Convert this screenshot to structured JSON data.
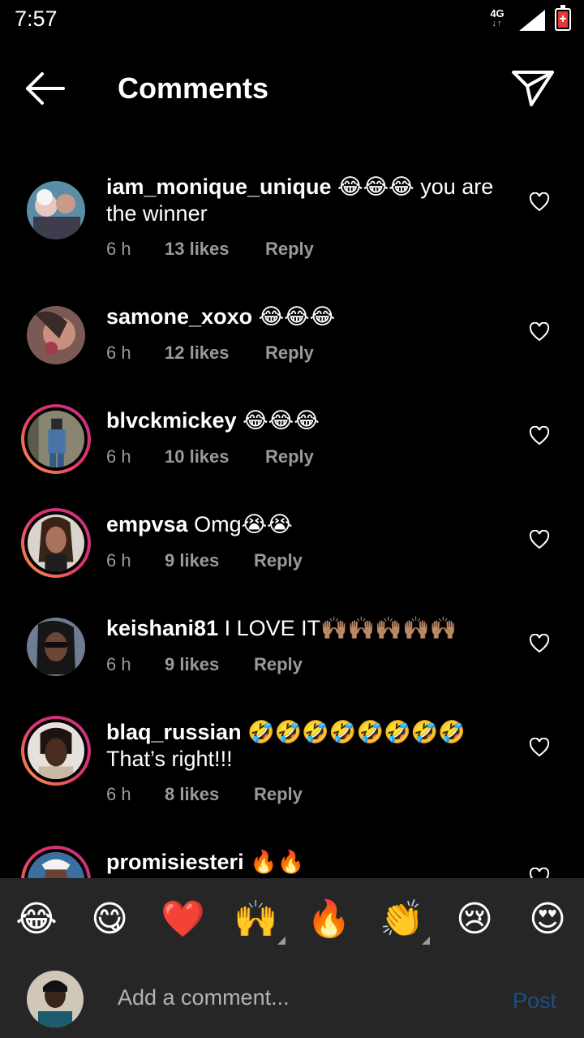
{
  "status_bar": {
    "time": "7:57",
    "network": "4G",
    "network_arrows": "↓↑"
  },
  "header": {
    "title": "Comments"
  },
  "comments": [
    {
      "username": "iam_monique_unique",
      "text": " 😂😂😂 you are the winner",
      "time": "6 h",
      "likes": "13 likes",
      "reply": "Reply"
    },
    {
      "username": "samone_xoxo",
      "text": " 😂😂😂",
      "time": "6 h",
      "likes": "12 likes",
      "reply": "Reply"
    },
    {
      "username": "blvckmickey",
      "text": " 😂😂😂",
      "time": "6 h",
      "likes": "10 likes",
      "reply": "Reply"
    },
    {
      "username": "empvsa",
      "text": " Omg😭😭",
      "time": "6 h",
      "likes": "9 likes",
      "reply": "Reply"
    },
    {
      "username": "keishani81",
      "text": " I LOVE IT🙌🏽🙌🏽🙌🏽🙌🏽🙌🏽",
      "time": "6 h",
      "likes": "9 likes",
      "reply": "Reply"
    },
    {
      "username": "blaq_russian",
      "text": " 🤣🤣🤣🤣🤣🤣🤣🤣 That’s right!!!",
      "time": "6 h",
      "likes": "8 likes",
      "reply": "Reply"
    },
    {
      "username": "promisiesteri",
      "text": " 🔥🔥"
    }
  ],
  "emoji_bar": [
    "😂",
    "😋",
    "❤️",
    "🙌",
    "🔥",
    "👏",
    "😢",
    "😍"
  ],
  "compose": {
    "placeholder": "Add a comment...",
    "post_label": "Post"
  },
  "colors": {
    "background": "#000000",
    "bar": "#262626",
    "meta_text": "#9a9a9a",
    "post_disabled": "#1d4d86",
    "battery_low": "#e53935"
  }
}
